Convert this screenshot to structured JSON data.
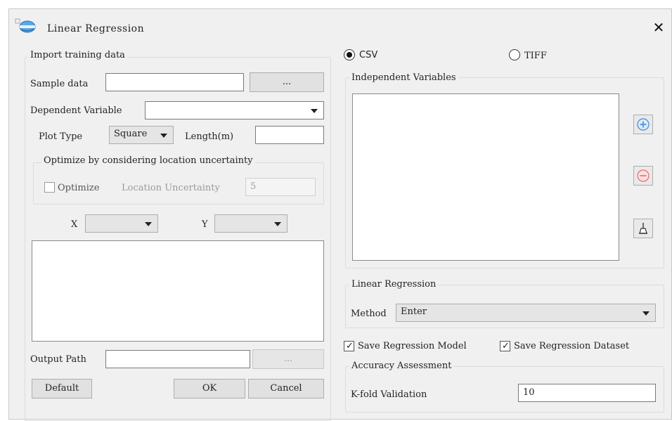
{
  "window": {
    "title": "Linear Regression"
  },
  "import_group": {
    "title": "Import training data",
    "sample_data_label": "Sample data",
    "sample_data_value": "",
    "browse_label": "...",
    "dependent_variable_label": "Dependent Variable",
    "dependent_variable_value": "",
    "plot_type_label": "Plot Type",
    "plot_type_value": "Square",
    "length_label": "Length(m)",
    "length_value": ""
  },
  "optimize_group": {
    "title": "Optimize by considering location uncertainty",
    "optimize_label": "Optimize",
    "optimize_checked": false,
    "location_uncertainty_label": "Location Uncertainty",
    "location_uncertainty_value": "5"
  },
  "xy": {
    "x_label": "X",
    "x_value": "",
    "y_label": "Y",
    "y_value": ""
  },
  "output": {
    "path_label": "Output Path",
    "path_value": "",
    "browse_label": "..."
  },
  "buttons": {
    "default_label": "Default",
    "ok_label": "OK",
    "cancel_label": "Cancel"
  },
  "format": {
    "csv_label": "CSV",
    "csv_selected": true,
    "tiff_label": "TIFF",
    "tiff_selected": false
  },
  "independent_group": {
    "title": "Independent Variables",
    "add_icon": "plus-circle-icon",
    "remove_icon": "minus-circle-icon",
    "clear_icon": "broom-icon"
  },
  "regression_group": {
    "title": "Linear Regression",
    "method_label": "Method",
    "method_value": "Enter"
  },
  "save_options": {
    "save_model_label": "Save Regression Model",
    "save_model_checked": true,
    "save_dataset_label": "Save Regression Dataset",
    "save_dataset_checked": true
  },
  "accuracy_group": {
    "title": "Accuracy Assessment",
    "kfold_label": "K-fold Validation",
    "kfold_value": "10"
  },
  "colors": {
    "dialog_bg": "#f0f0f0",
    "add_icon_color": "#3a8de0",
    "remove_icon_color": "#e56b6b"
  }
}
